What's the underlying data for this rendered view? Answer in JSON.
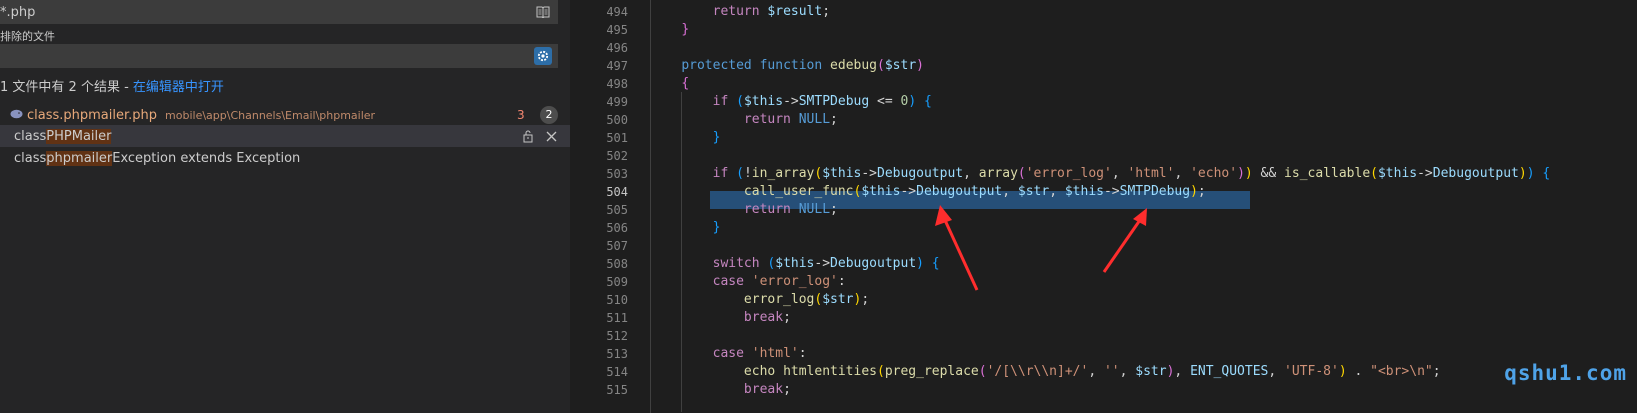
{
  "search": {
    "include_value": "*.php",
    "exclude_label": "排除的文件",
    "exclude_value": "",
    "summary_prefix": "1 文件中有 2 个结果 - ",
    "summary_link": "在编辑器中打开"
  },
  "result_file": {
    "name": "class.phpmailer.php",
    "path": "mobile\\app\\Channels\\Email\\phpmailer",
    "problems": "3",
    "match_count": "2"
  },
  "matches": [
    {
      "pre": "class ",
      "hl": "PHPMailer",
      "post": ""
    },
    {
      "pre": "class ",
      "hl": "phpmailer",
      "post": "Exception extends Exception"
    }
  ],
  "editor": {
    "line_numbers": [
      "494",
      "495",
      "496",
      "497",
      "498",
      "499",
      "500",
      "501",
      "502",
      "503",
      "504",
      "505",
      "506",
      "507",
      "508",
      "509",
      "510",
      "511",
      "512",
      "513",
      "514",
      "515"
    ],
    "active_line": "504"
  },
  "watermark": "qshu1.com",
  "colors": {
    "selection": "#264f78",
    "match_highlight": "#613214",
    "annotation_arrow": "#ff2d2d"
  }
}
